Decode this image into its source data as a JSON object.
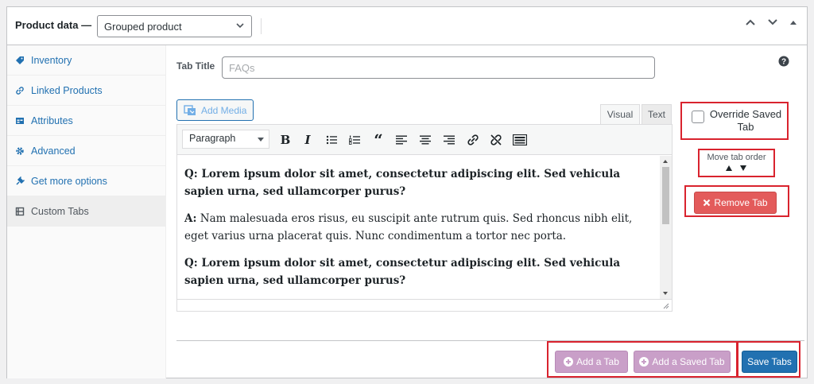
{
  "header": {
    "label": "Product data —",
    "product_type": "Grouped product"
  },
  "sidebar": {
    "items": [
      {
        "label": "Inventory",
        "icon": "tag-icon"
      },
      {
        "label": "Linked Products",
        "icon": "link-icon"
      },
      {
        "label": "Attributes",
        "icon": "table-icon"
      },
      {
        "label": "Advanced",
        "icon": "gear-icon"
      },
      {
        "label": "Get more options",
        "icon": "plugin-icon"
      },
      {
        "label": "Custom Tabs",
        "icon": "tabs-icon",
        "active": true
      }
    ]
  },
  "tab_title": {
    "label": "Tab Title",
    "placeholder": "FAQs"
  },
  "editor": {
    "add_media_label": "Add Media",
    "tab_visual": "Visual",
    "tab_text": "Text",
    "format": "Paragraph",
    "paragraphs": [
      {
        "strong": "Q: Lorem ipsum dolor sit amet, consectetur adipiscing elit. Sed vehicula sapien urna, sed ullamcorper purus?",
        "rest": ""
      },
      {
        "strong": "A:",
        "rest": " Nam malesuada eros risus, eu suscipit ante rutrum quis. Sed rhoncus nibh elit, eget varius urna placerat quis. Nunc condimentum a tortor nec porta."
      },
      {
        "strong": "Q: Lorem ipsum dolor sit amet, consectetur adipiscing elit. Sed vehicula sapien urna, sed ullamcorper purus?",
        "rest": ""
      }
    ]
  },
  "right": {
    "override_label": "Override Saved Tab",
    "move_label": "Move tab order",
    "remove_label": "Remove Tab"
  },
  "footer": {
    "add_tab": "Add a Tab",
    "add_saved_tab": "Add a Saved Tab",
    "save_tabs": "Save Tabs"
  },
  "colors": {
    "accent": "#2271b1",
    "highlight": "#d9232e",
    "remove": "#e35b5b",
    "pink": "#c99fc8"
  }
}
